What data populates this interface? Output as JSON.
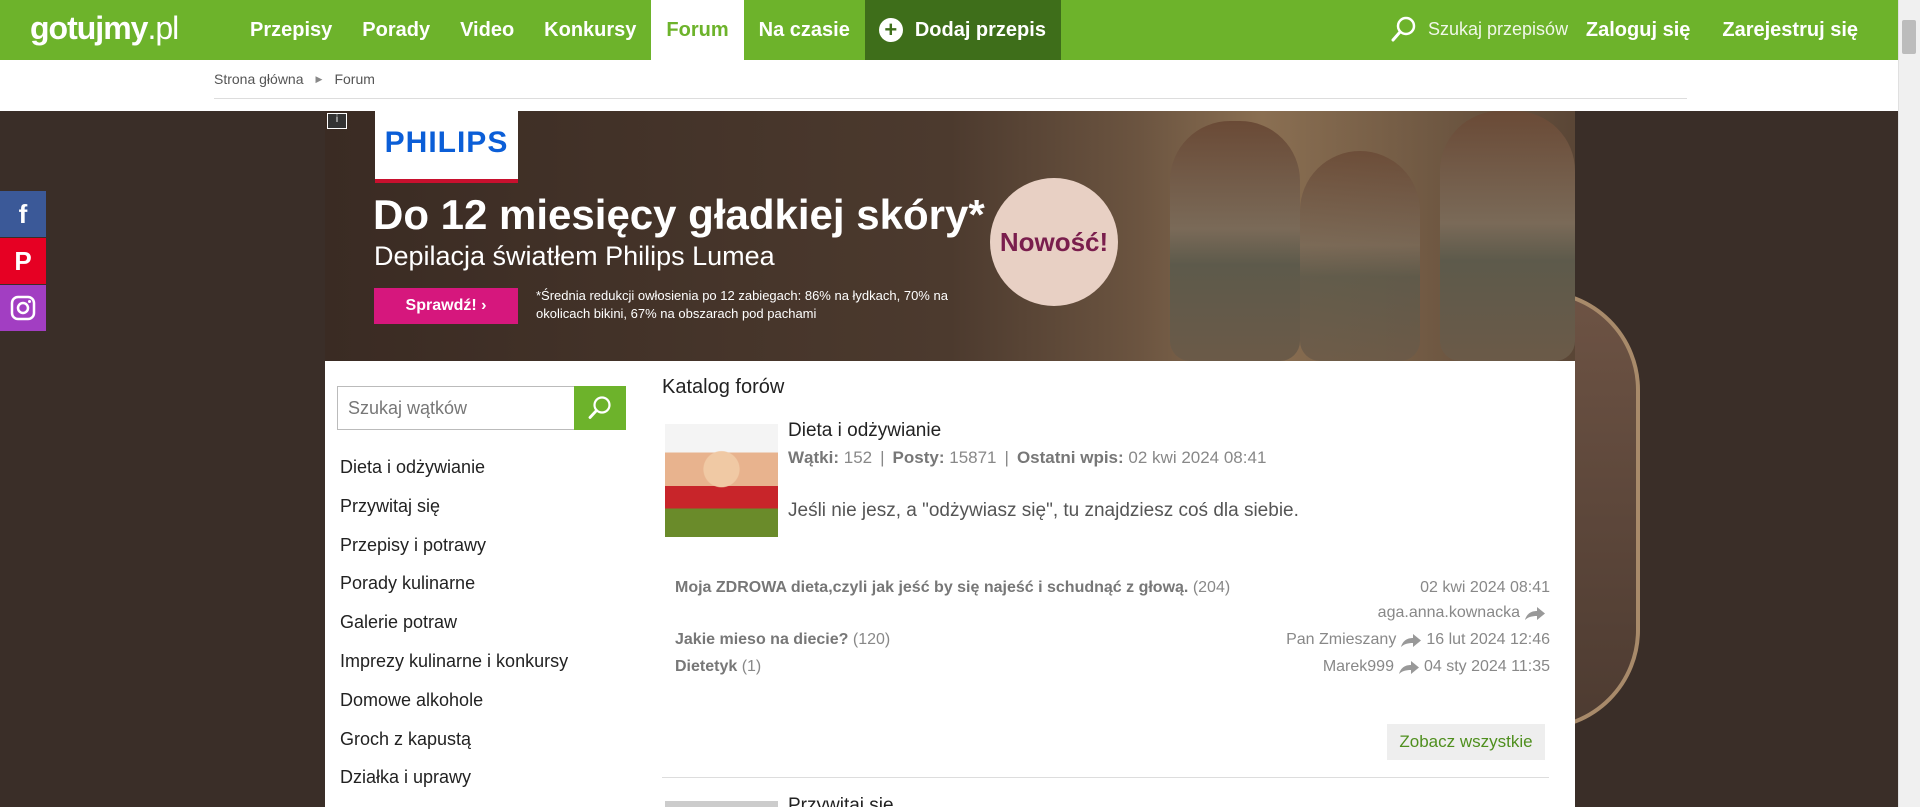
{
  "header": {
    "logo_main": "gotujmy",
    "logo_suffix": ".pl",
    "nav": [
      "Przepisy",
      "Porady",
      "Video",
      "Konkursy",
      "Forum",
      "Na czasie"
    ],
    "add_recipe": "Dodaj przepis",
    "search_placeholder": "Szukaj przepisów",
    "login": "Zaloguj się",
    "register": "Zarejestruj się",
    "colors": {
      "green": "#6db32b",
      "dark_green": "#3e6e1a"
    }
  },
  "breadcrumb": [
    "Strona główna",
    "Forum"
  ],
  "ad": {
    "brand": "PHILIPS",
    "title": "Do 12 miesięcy gładkiej skóry*",
    "subtitle": "Depilacja światłem Philips Lumea",
    "button": "Sprawdź! ›",
    "note": "*Średnia redukcji owłosienia po 12 zabiegach: 86% na łydkach, 70% na okolicach bikini, 67% na obszarach pod pachami",
    "badge": "Nowość!"
  },
  "sidebar": {
    "search_placeholder": "Szukaj wątków",
    "items": [
      "Dieta i odżywianie",
      "Przywitaj się",
      "Przepisy i potrawy",
      "Porady kulinarne",
      "Galerie potraw",
      "Imprezy kulinarne i konkursy",
      "Domowe alkohole",
      "Groch z kapustą",
      "Działka i uprawy"
    ]
  },
  "main": {
    "catalog_title": "Katalog forów",
    "forum": {
      "name": "Dieta i odżywianie",
      "threads_label": "Wątki:",
      "threads": "152",
      "posts_label": "Posty:",
      "posts": "15871",
      "last_label": "Ostatni wpis:",
      "last": "02 kwi 2024 08:41",
      "description": "Jeśli nie jesz, a \"odżywiasz się\", tu znajdziesz coś dla siebie."
    },
    "threads": [
      {
        "title": "Moja ZDROWA dieta,czyli jak jeść by się najeść i schudnąć z głową.",
        "count": "(204)",
        "date": "02 kwi 2024 08:41",
        "user": "aga.anna.kownacka"
      },
      {
        "title": "Jakie mieso na diecie?",
        "count": "(120)",
        "user": "Pan Zmieszany",
        "date": "16 lut 2024 12:46"
      },
      {
        "title": "Dietetyk",
        "count": "(1)",
        "user": "Marek999",
        "date": "04 sty 2024 11:35"
      }
    ],
    "see_all": "Zobacz wszystkie",
    "next_forum": "Przywitaj się"
  },
  "social": {
    "facebook": "f",
    "pinterest": "P",
    "instagram": "ig"
  }
}
